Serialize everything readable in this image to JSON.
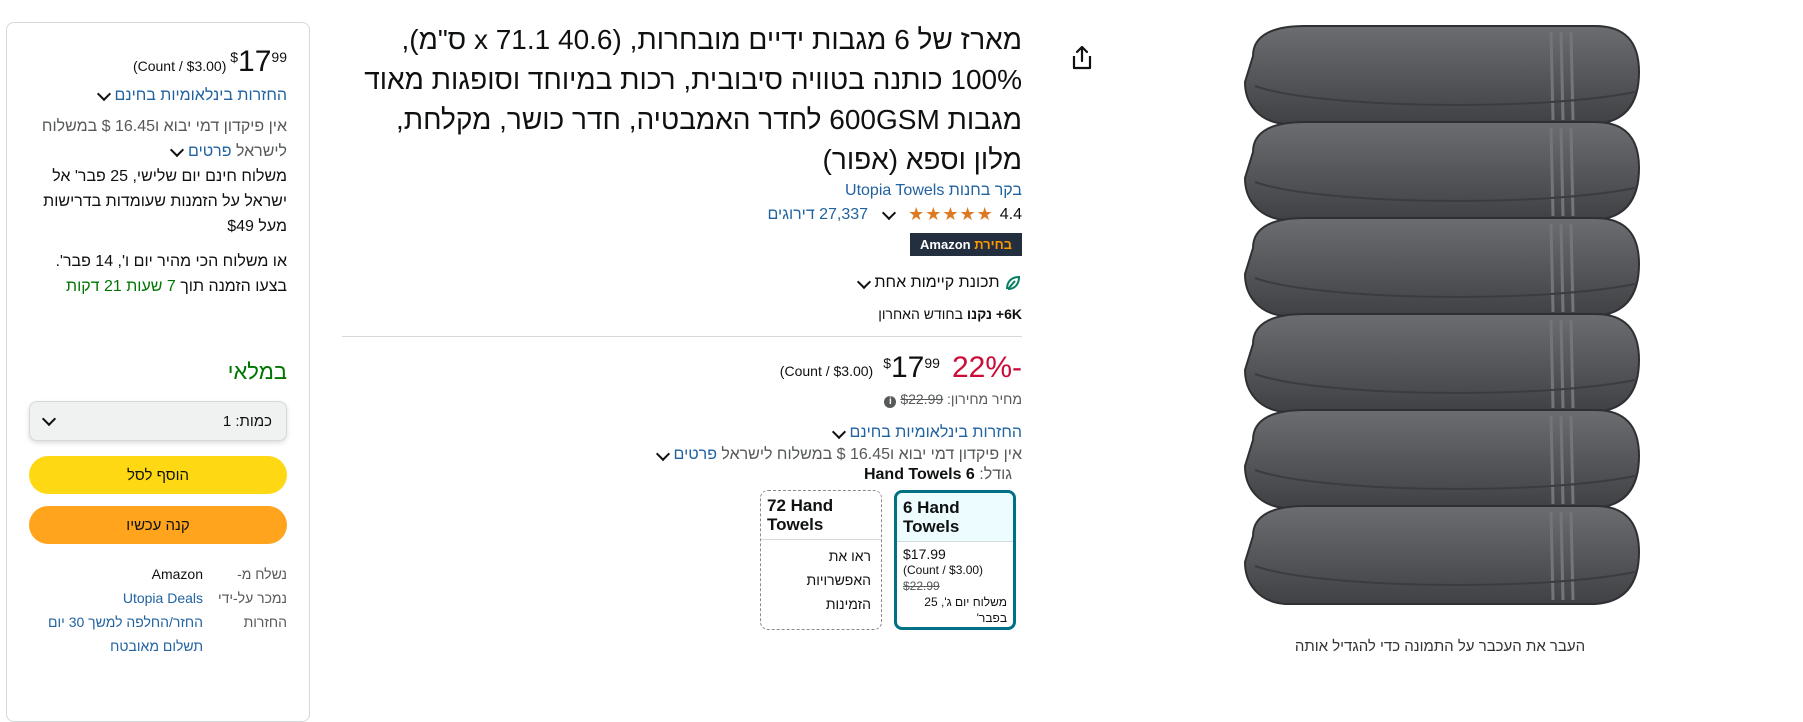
{
  "buybox": {
    "price_currency": "$",
    "price_whole": "17",
    "price_fraction": "99",
    "unit_price": "(Count / $3.00)",
    "returns_label": "החזרות בינלאומיות בחינם",
    "no_deposit_line": "אין פיקדון דמי יבוא ו16.45 $ במשלוח לישראל",
    "details_link": "פרטים",
    "free_delivery_line": "משלוח חינם יום שלישי, 25 פבר' אל ישראל על הזמנות שעומדות בדרישות מעל $49",
    "fastest_delivery_line": "או משלוח הכי מהיר יום ו', 14 פבר'.",
    "order_within_prefix": "בצעו הזמנה תוך",
    "order_within_time": "7 שעות 21 דקות",
    "in_stock": "במלאי",
    "quantity_label": "כמות:",
    "quantity_value": "1",
    "add_to_cart": "הוסף לסל",
    "buy_now": "קנה עכשיו",
    "ships_from_label": "נשלח מ-",
    "ships_from_value": "Amazon",
    "sold_by_label": "נמכר על-ידי",
    "sold_by_value": "Utopia Deals",
    "returns_row_label": "החזרות",
    "returns_row_value": "החזר/החלפה למשך 30 יום",
    "payment_row_value": "תשלום מאובטח"
  },
  "product": {
    "title": "מארז של 6 מגבות ידיים מובחרות, (40.6 x 71.1 ס\"מ), 100% כותנה בטוויה סיבובית, רכות במיוחד וסופגות מאוד מגבות 600GSM לחדר האמבטיה, חדר כושר, מקלחת, מלון וספא (אפור)",
    "store_link": "בקר בחנות Utopia Towels",
    "rating": "4.4",
    "ratings_count": "27,337 דירוגים",
    "badge_prefix": "Amazon",
    "badge_suffix": "בחירת",
    "sustainability": "תכונת קיימות אחת",
    "bought_bold": "6K+ נקנו",
    "bought_rest": "בחודש האחרון",
    "discount": "-22%",
    "price_currency": "$",
    "price_whole": "17",
    "price_fraction": "99",
    "unit_price": "(Count / $3.00)",
    "list_price_label": "מחיר מחירון:",
    "list_price_value": "$22.99",
    "returns_label": "החזרות בינלאומיות בחינם",
    "no_deposit_line": "אין פיקדון דמי יבוא ו16.45 $ במשלוח לישראל",
    "details_link": "פרטים",
    "size_label": "גודל:",
    "size_value": "6 Hand Towels"
  },
  "swatches": [
    {
      "name": "6 Hand Towels",
      "price": "$17.99",
      "unit": "(Count / $3.00)",
      "list": "$22.99",
      "delivery": "משלוח יום ג', 25 בפבר'"
    },
    {
      "name": "72 Hand Towels",
      "see_options": "ראו את האפשרויות הזמינות"
    }
  ],
  "image": {
    "caption": "העבר את העכבר על התמונה כדי להגדיל אותה",
    "towel_color": "#55575a"
  },
  "icons": {
    "share": "share-icon",
    "leaf": "leaf-icon",
    "info": "info-icon"
  }
}
